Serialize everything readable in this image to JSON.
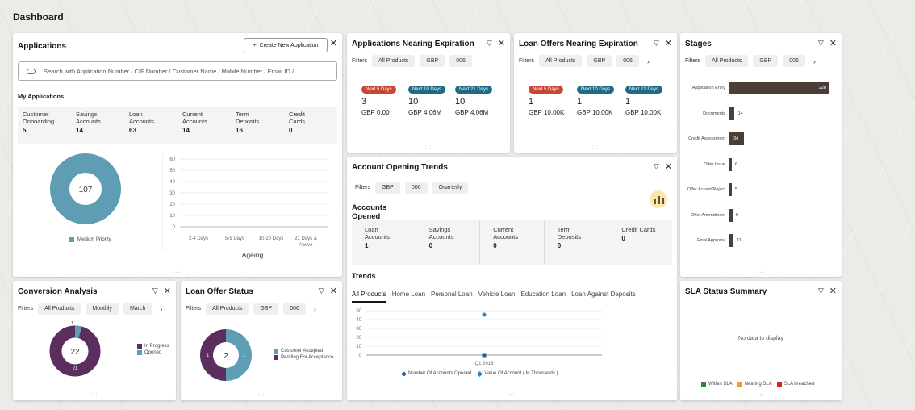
{
  "page_title": "Dashboard",
  "applications": {
    "title": "Applications",
    "create_button": "Create New Application",
    "search_placeholder": "Search with Application Number / CIF Number / Customer Name / Mobile Number / Email ID /",
    "my_applications": "My Applications",
    "counts": [
      {
        "label1": "Customer",
        "label2": "Onboarding",
        "value": "5"
      },
      {
        "label1": "Savings",
        "label2": "Accounts",
        "value": "14"
      },
      {
        "label1": "Loan",
        "label2": "Accounts",
        "value": "63"
      },
      {
        "label1": "Current",
        "label2": "Accounts",
        "value": "14"
      },
      {
        "label1": "Term",
        "label2": "Deposits",
        "value": "16"
      },
      {
        "label1": "Credit",
        "label2": "Cards",
        "value": "0"
      }
    ],
    "donut_center": "107",
    "donut_legend": "Medium Priority",
    "ageing_ticks": [
      "60",
      "50",
      "40",
      "30",
      "20",
      "10",
      "0"
    ],
    "ageing_categories": [
      "2-4 Days",
      "5-9 Days",
      "10-20 Days",
      "21 Days &",
      "Above"
    ],
    "ageing_label": "Ageing"
  },
  "expiration": {
    "title": "Applications Nearing Expiration",
    "filters_label": "Filters",
    "filters": [
      "All Products",
      "GBP",
      "006"
    ],
    "cols": [
      {
        "pill": "Next 5 Days",
        "count": "3",
        "amount": "GBP 0.00"
      },
      {
        "pill": "Next 10 Days",
        "count": "10",
        "amount": "GBP 4.06M"
      },
      {
        "pill": "Next 21 Days",
        "count": "10",
        "amount": "GBP 4.06M"
      }
    ]
  },
  "loan_offers": {
    "title": "Loan Offers Nearing Expiration",
    "filters_label": "Filters",
    "filters": [
      "All Products",
      "GBP",
      "006"
    ],
    "cols": [
      {
        "pill": "Next 5 Days",
        "count": "1",
        "amount": "GBP 10.00K"
      },
      {
        "pill": "Next 10 Days",
        "count": "1",
        "amount": "GBP 10.00K"
      },
      {
        "pill": "Next 21 Days",
        "count": "1",
        "amount": "GBP 10.00K"
      }
    ]
  },
  "stages": {
    "title": "Stages",
    "filters_label": "Filters",
    "filters": [
      "All Products",
      "GBP",
      "006"
    ],
    "items": [
      {
        "label": "Application Entry",
        "value": "228",
        "frac": 1.0
      },
      {
        "label": "Documents",
        "value": "14",
        "frac": 0.06
      },
      {
        "label": "Credit Assessment",
        "value": "34",
        "frac": 0.15
      },
      {
        "label": "Offer Issue",
        "value": "6",
        "frac": 0.03
      },
      {
        "label": "Offer Accept/Reject",
        "value": "5",
        "frac": 0.02
      },
      {
        "label": "Offer Amendment",
        "value": "9",
        "frac": 0.04
      },
      {
        "label": "Final Approval",
        "value": "11",
        "frac": 0.05
      }
    ]
  },
  "account_trends": {
    "title": "Account Opening Trends",
    "filters_label": "Filters",
    "filters": [
      "GBP",
      "006",
      "Quarterly"
    ],
    "section_title": "Accounts Opened",
    "counts": [
      {
        "label1": "Loan",
        "label2": "Accounts",
        "value": "1"
      },
      {
        "label1": "Savings",
        "label2": "Accounts",
        "value": "0"
      },
      {
        "label1": "Current",
        "label2": "Accounts",
        "value": "0"
      },
      {
        "label1": "Term",
        "label2": "Deposits",
        "value": "0"
      },
      {
        "label1": "Credit Cards",
        "label2": "",
        "value": "0"
      }
    ],
    "trends_title": "Trends",
    "tabs": [
      "All Products",
      "Home Loan",
      "Personal Loan",
      "Vehicle Loan",
      "Education Loan",
      "Loan Against Deposits"
    ],
    "y_ticks": [
      "50",
      "40",
      "30",
      "20",
      "10",
      "0"
    ],
    "x_label": "Q1 2018",
    "legend": [
      "Number Of Accounts Opened",
      "Value Of Account ( In Thousands )"
    ]
  },
  "conversion": {
    "title": "Conversion Analysis",
    "filters_label": "Filters",
    "filters": [
      "All Products",
      "Monthly",
      "March"
    ],
    "center": "22",
    "top_label": "1",
    "bottom_label": "21",
    "legend": [
      "In Progress",
      "Opened"
    ],
    "colors": {
      "in_progress": "#5b2e5e",
      "opened": "#5f9db4"
    }
  },
  "loan_status": {
    "title": "Loan Offer Status",
    "filters_label": "Filters",
    "filters": [
      "All Products",
      "GBP",
      "006"
    ],
    "center": "2",
    "left_label": "1",
    "right_label": "1",
    "legend": [
      "Customer Accepted",
      "Pending For Acceptance"
    ]
  },
  "sla": {
    "title": "SLA Status Summary",
    "empty": "No data to display",
    "legend": [
      "Within SLA",
      "Nearing SLA",
      "SLA breached"
    ],
    "colors": {
      "within": "#2e8b2e",
      "nearing": "#f29a2e",
      "breached": "#e12222"
    }
  }
}
